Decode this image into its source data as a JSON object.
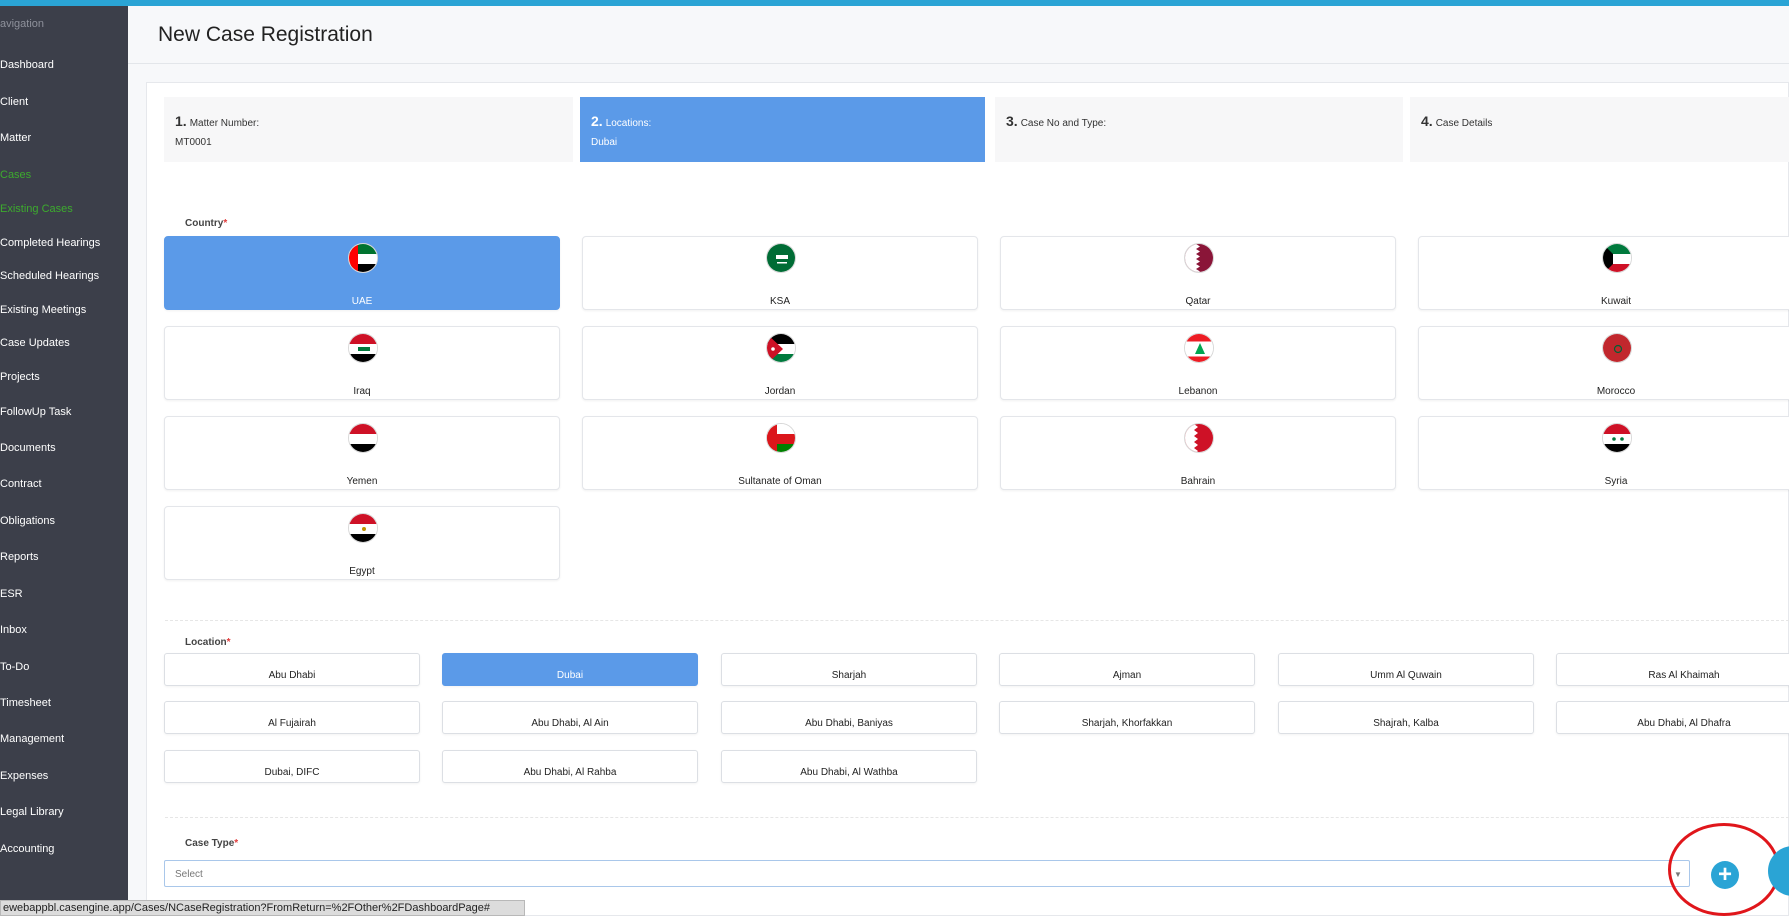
{
  "sidebar": {
    "heading": "avigation",
    "items": [
      {
        "label": "Dashboard"
      },
      {
        "label": "Client"
      },
      {
        "label": "Matter"
      },
      {
        "label": "Cases"
      },
      {
        "label": "Existing Cases"
      },
      {
        "label": "Completed Hearings"
      },
      {
        "label": "Scheduled Hearings"
      },
      {
        "label": "Existing Meetings"
      },
      {
        "label": "Case Updates"
      },
      {
        "label": "Projects"
      },
      {
        "label": "FollowUp Task"
      },
      {
        "label": "Documents"
      },
      {
        "label": "Contract"
      },
      {
        "label": "Obligations"
      },
      {
        "label": "Reports"
      },
      {
        "label": "ESR"
      },
      {
        "label": "Inbox"
      },
      {
        "label": "To-Do"
      },
      {
        "label": "Timesheet"
      },
      {
        "label": "Management"
      },
      {
        "label": "Expenses"
      },
      {
        "label": "Legal Library"
      },
      {
        "label": "Accounting"
      }
    ]
  },
  "page_title": "New Case Registration",
  "steps": [
    {
      "num": "1.",
      "label": "Matter Number:",
      "value": "MT0001"
    },
    {
      "num": "2.",
      "label": "Locations:",
      "value": "Dubai"
    },
    {
      "num": "3.",
      "label": "Case No and Type:",
      "value": ""
    },
    {
      "num": "4.",
      "label": "Case Details",
      "value": ""
    }
  ],
  "country_section": {
    "label": "Country",
    "required_mark": "*"
  },
  "countries": [
    {
      "name": "UAE",
      "flag": "uae-flag"
    },
    {
      "name": "KSA",
      "flag": "ksa-flag"
    },
    {
      "name": "Qatar",
      "flag": "qatar-flag"
    },
    {
      "name": "Kuwait",
      "flag": "kuwait-flag"
    },
    {
      "name": "Iraq",
      "flag": "iraq-flag"
    },
    {
      "name": "Jordan",
      "flag": "jordan-flag"
    },
    {
      "name": "Lebanon",
      "flag": "lebanon-flag"
    },
    {
      "name": "Morocco",
      "flag": "morocco-flag"
    },
    {
      "name": "Yemen",
      "flag": "yemen-flag"
    },
    {
      "name": "Sultanate of Oman",
      "flag": "oman-flag"
    },
    {
      "name": "Bahrain",
      "flag": "bahrain-flag"
    },
    {
      "name": "Syria",
      "flag": "syria-flag"
    },
    {
      "name": "Egypt",
      "flag": "egypt-flag"
    }
  ],
  "selected_country": "UAE",
  "location_section": {
    "label": "Location",
    "required_mark": "*"
  },
  "locations": [
    "Abu Dhabi",
    "Dubai",
    "Sharjah",
    "Ajman",
    "Umm Al Quwain",
    "Ras Al Khaimah",
    "Al Fujairah",
    "Abu Dhabi, Al Ain",
    "Abu Dhabi, Baniyas",
    "Sharjah, Khorfakkan",
    "Shajrah, Kalba",
    "Abu Dhabi, Al Dhafra",
    "Dubai, DIFC",
    "Abu Dhabi, Al Rahba",
    "Abu Dhabi, Al Wathba"
  ],
  "selected_location": "Dubai",
  "case_type_section": {
    "label": "Case Type",
    "required_mark": "*",
    "placeholder": "Select"
  },
  "status_url": "ewebappbl.casengine.app/Cases/NCaseRegistration?FromReturn=%2FOther%2FDashboardPage#",
  "colors": {
    "accent": "#5b9ae8",
    "sidebar": "#3c3f4a",
    "active_nav": "#3dab2e",
    "annotation": "#e0161b",
    "add_button": "#2aa4d5"
  },
  "icons": {
    "add": "plus-circle-icon"
  }
}
